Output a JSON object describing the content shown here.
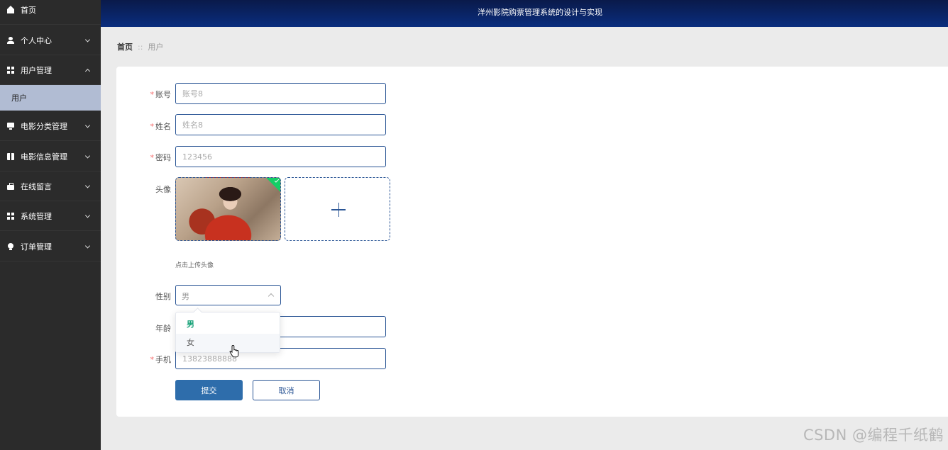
{
  "header": {
    "title": "洋州影院购票管理系统的设计与实现"
  },
  "sidebar": {
    "items": [
      {
        "label": "首页",
        "icon": "home-icon"
      },
      {
        "label": "个人中心",
        "icon": "user-icon"
      },
      {
        "label": "用户管理",
        "icon": "grid-icon",
        "expanded": true
      },
      {
        "label": "电影分类管理",
        "icon": "monitor-icon"
      },
      {
        "label": "电影信息管理",
        "icon": "book-icon"
      },
      {
        "label": "在线留言",
        "icon": "briefcase-icon"
      },
      {
        "label": "系统管理",
        "icon": "grid-icon"
      },
      {
        "label": "订单管理",
        "icon": "bulb-icon"
      }
    ],
    "sub_item": {
      "label": "用户",
      "active": true
    }
  },
  "breadcrumb": {
    "home": "首页",
    "separator": "::",
    "current": "用户"
  },
  "form": {
    "account": {
      "label": "账号",
      "placeholder": "账号8"
    },
    "name": {
      "label": "姓名",
      "placeholder": "姓名8"
    },
    "password": {
      "label": "密码",
      "placeholder": "123456"
    },
    "avatar": {
      "label": "头像",
      "hint": "点击上传头像"
    },
    "gender": {
      "label": "性别",
      "value": "男",
      "options": [
        "男",
        "女"
      ]
    },
    "age": {
      "label": "年龄",
      "placeholder": ""
    },
    "phone": {
      "label": "手机",
      "placeholder": "13823888888"
    },
    "submit_label": "提交",
    "cancel_label": "取消"
  },
  "colors": {
    "header": "#0a2d7e",
    "sidebar": "#2b2b2b",
    "active_sub": "#b1bcd3",
    "primary": "#2e6dab",
    "required": "#f56c6c",
    "selected_option": "#1aa37a",
    "badge": "#13ce66"
  },
  "watermark": "CSDN @编程千纸鹤"
}
